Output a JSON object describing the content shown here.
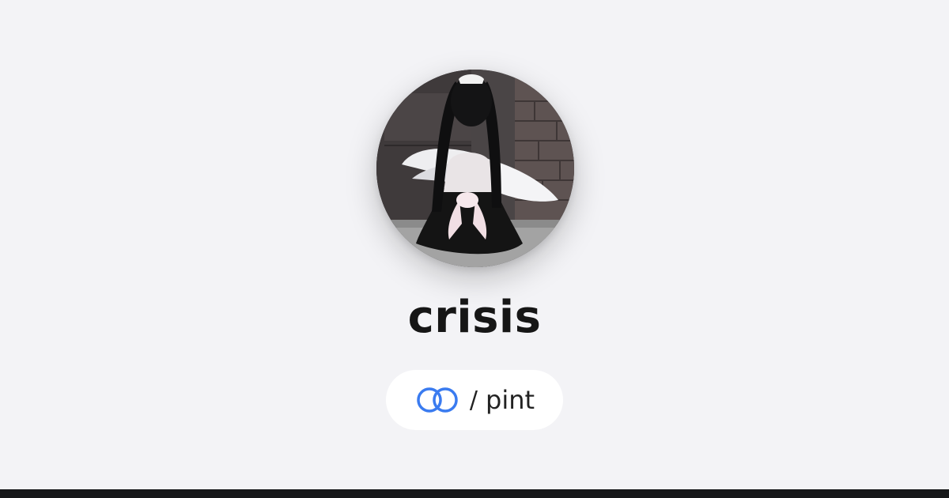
{
  "profile": {
    "display_name": "crisis",
    "avatar_icon": "avatar-photo"
  },
  "handle": {
    "logo_icon": "interlocked-rings-logo-icon",
    "separator": "/",
    "username": "pint"
  },
  "colors": {
    "background": "#f3f3f6",
    "logo_accent": "#3a7bf0",
    "text": "#161616",
    "bottom_bar": "#17181a"
  }
}
